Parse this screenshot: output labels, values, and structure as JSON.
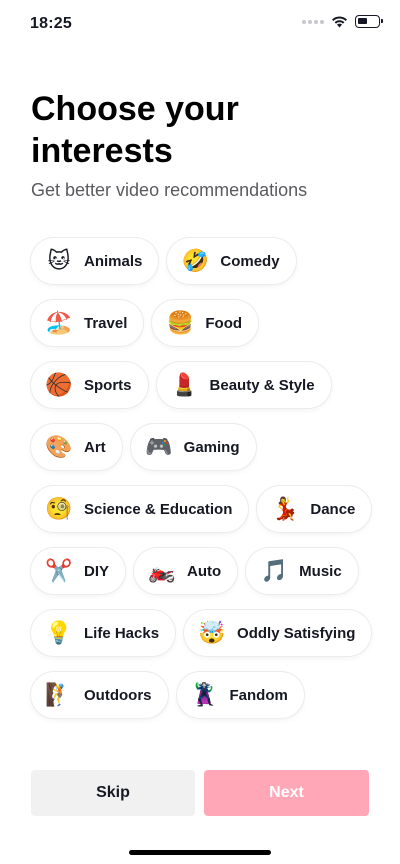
{
  "status_bar": {
    "time": "18:25"
  },
  "header": {
    "title": "Choose your interests",
    "subtitle": "Get better video recommendations"
  },
  "interests": [
    {
      "label": "Animals",
      "icon": "🐱",
      "icon_name": "cat-face-icon"
    },
    {
      "label": "Comedy",
      "icon": "🤣",
      "icon_name": "rolling-laughing-icon"
    },
    {
      "label": "Travel",
      "icon": "🏖️",
      "icon_name": "beach-umbrella-icon"
    },
    {
      "label": "Food",
      "icon": "🍔",
      "icon_name": "hamburger-icon"
    },
    {
      "label": "Sports",
      "icon": "🏀",
      "icon_name": "basketball-icon"
    },
    {
      "label": "Beauty & Style",
      "icon": "💄",
      "icon_name": "lipstick-icon"
    },
    {
      "label": "Art",
      "icon": "🎨",
      "icon_name": "palette-icon"
    },
    {
      "label": "Gaming",
      "icon": "🎮",
      "icon_name": "gamepad-icon"
    },
    {
      "label": "Science & Education",
      "icon": "🧐",
      "icon_name": "monocle-face-icon"
    },
    {
      "label": "Dance",
      "icon": "💃",
      "icon_name": "dancer-icon"
    },
    {
      "label": "DIY",
      "icon": "✂️",
      "icon_name": "scissors-icon"
    },
    {
      "label": "Auto",
      "icon": "🏍️",
      "icon_name": "motorcycle-icon"
    },
    {
      "label": "Music",
      "icon": "🎵",
      "icon_name": "music-note-icon"
    },
    {
      "label": "Life Hacks",
      "icon": "💡",
      "icon_name": "light-bulb-icon"
    },
    {
      "label": "Oddly Satisfying",
      "icon": "🤯",
      "icon_name": "exploding-head-icon"
    },
    {
      "label": "Outdoors",
      "icon": "🧗",
      "icon_name": "climber-icon"
    },
    {
      "label": "Fandom",
      "icon": "🦹",
      "icon_name": "supervillain-icon"
    }
  ],
  "buttons": {
    "skip": "Skip",
    "next": "Next"
  },
  "colors": {
    "next_disabled": "#ffa7b7",
    "skip_bg": "#f1f1f2",
    "text": "#161823"
  }
}
